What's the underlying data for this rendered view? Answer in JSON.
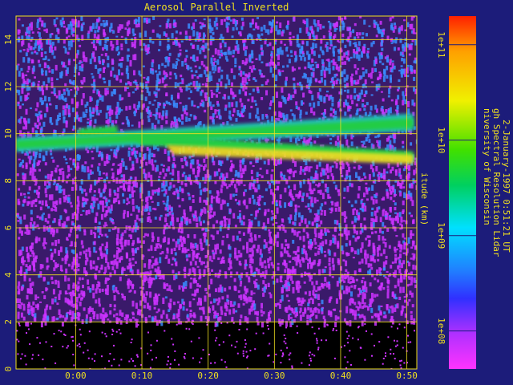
{
  "chart_data": {
    "type": "heatmap",
    "title": "Aerosol Parallel Inverted",
    "ylabel": "itude (km)",
    "ylim": [
      0,
      15
    ],
    "yticks": [
      "0",
      "2",
      "4",
      "6",
      "8",
      "10",
      "12",
      "14"
    ],
    "xticks": [
      "0:00",
      "0:10",
      "0:20",
      "0:30",
      "0:40",
      "0:50"
    ],
    "grid": true,
    "colorbar": {
      "scale": "log",
      "range": [
        "4e7",
        "2e11"
      ],
      "ticks": [
        "1e+08",
        "1e+09",
        "1e+10",
        "1e+11"
      ]
    },
    "info_lines": [
      "niversity of Wisconsin",
      "gh Spectral Resolution Lidar",
      "2-January-1997 0:51:21 UT"
    ],
    "features": [
      {
        "label": "",
        "altitude_km": [
          9.1,
          10.6
        ],
        "time_range": [
          "-0:07",
          "0:51"
        ]
      }
    ]
  },
  "colors": {
    "background": "#1c1c7a",
    "axis": "#f0e020",
    "noise_primary": "#cc33ff",
    "noise_secondary": "#3a8cff",
    "layer_core": "#f0e020",
    "layer_edge": "#22cc44"
  }
}
